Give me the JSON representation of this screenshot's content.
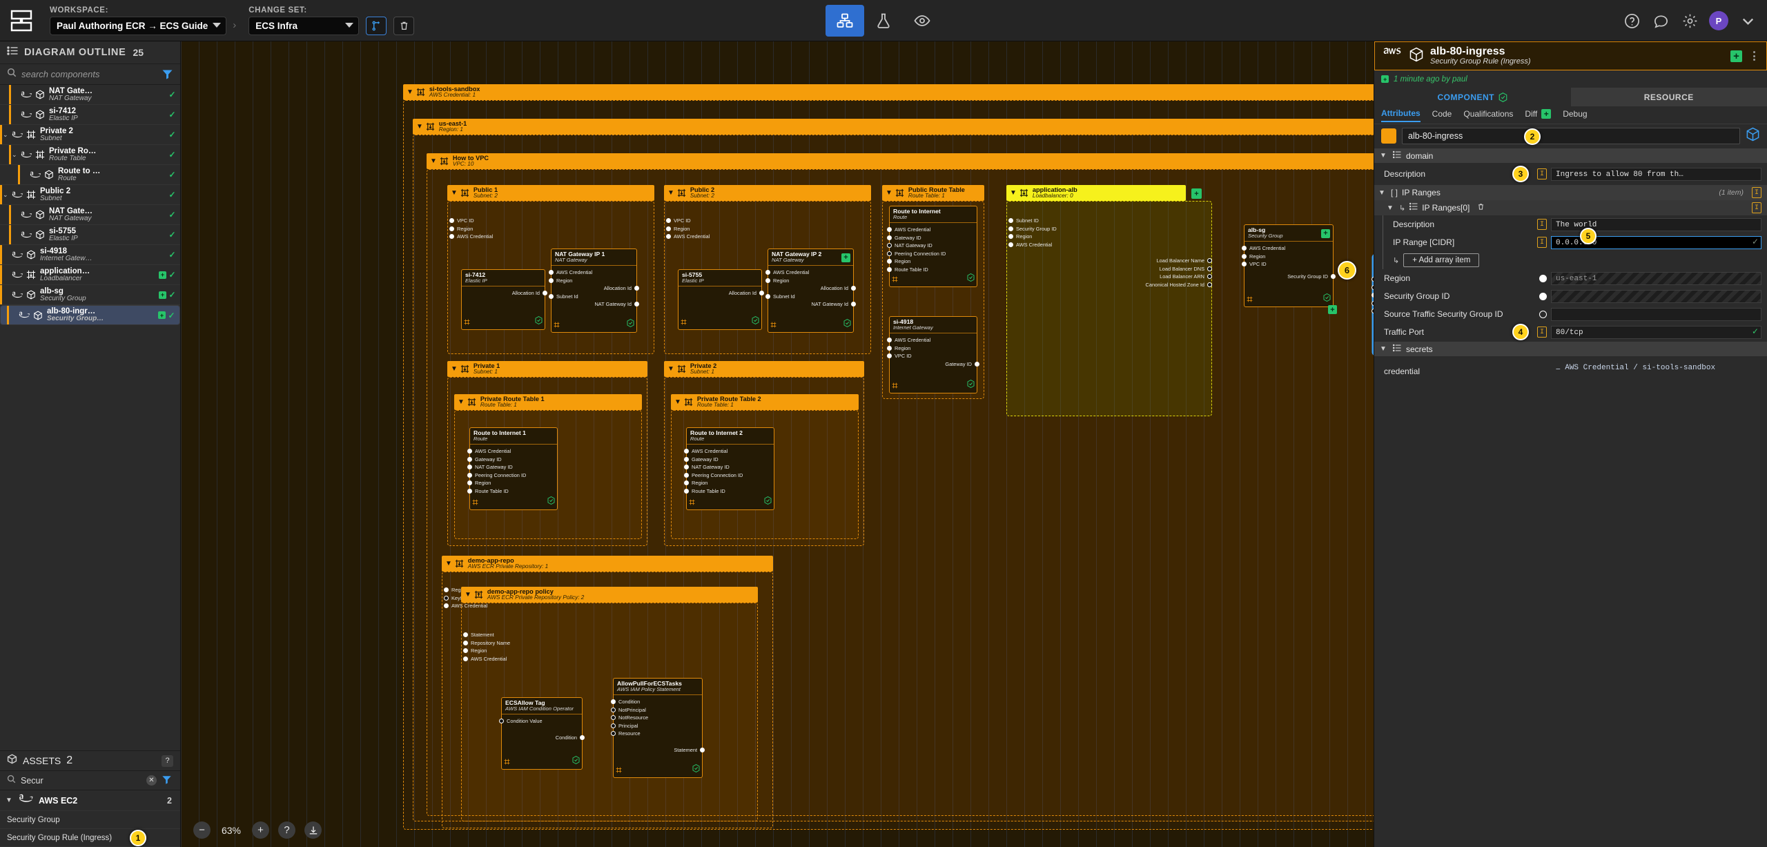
{
  "topbar": {
    "workspace_label": "WORKSPACE:",
    "workspace_value": "Paul Authoring ECR → ECS Guide",
    "changeset_label": "CHANGE SET:",
    "changeset_value": "ECS Infra",
    "separator": "›",
    "avatar_initial": "P"
  },
  "outline": {
    "title": "DIAGRAM OUTLINE",
    "count": "25",
    "search_placeholder": "search components",
    "items": [
      {
        "name": "NAT Gate…",
        "kind": "NAT Gateway",
        "depth": 2,
        "icon": "cube",
        "chevron": false,
        "plus": false,
        "check": true
      },
      {
        "name": "si-7412",
        "kind": "Elastic IP",
        "depth": 2,
        "icon": "cube",
        "chevron": false,
        "plus": false,
        "check": true
      },
      {
        "name": "Private 2",
        "kind": "Subnet",
        "depth": 1,
        "icon": "subnet",
        "chevron": true,
        "plus": false,
        "check": true
      },
      {
        "name": "Private Ro…",
        "kind": "Route Table",
        "depth": 2,
        "icon": "subnet",
        "chevron": true,
        "plus": false,
        "check": true
      },
      {
        "name": "Route to …",
        "kind": "Route",
        "depth": 3,
        "icon": "cube",
        "chevron": false,
        "plus": false,
        "check": true
      },
      {
        "name": "Public 2",
        "kind": "Subnet",
        "depth": 1,
        "icon": "subnet",
        "chevron": true,
        "plus": false,
        "check": true
      },
      {
        "name": "NAT Gate…",
        "kind": "NAT Gateway",
        "depth": 2,
        "icon": "cube",
        "chevron": false,
        "plus": false,
        "check": true
      },
      {
        "name": "si-5755",
        "kind": "Elastic IP",
        "depth": 2,
        "icon": "cube",
        "chevron": false,
        "plus": false,
        "check": true
      },
      {
        "name": "si-4918",
        "kind": "Internet Gatew…",
        "depth": 1,
        "icon": "cube",
        "chevron": false,
        "plus": false,
        "check": true
      },
      {
        "name": "application…",
        "kind": "Loadbalancer",
        "depth": 1,
        "icon": "subnet",
        "chevron": false,
        "plus": true,
        "check": true
      },
      {
        "name": "alb-sg",
        "kind": "Security Group",
        "depth": 1,
        "icon": "cube",
        "chevron": false,
        "plus": true,
        "check": true
      },
      {
        "name": "alb-80-ingr…",
        "kind": "Security Group…",
        "depth": 1,
        "icon": "cube",
        "chevron": false,
        "plus": true,
        "check": true,
        "selected": true
      }
    ]
  },
  "assets": {
    "title": "ASSETS",
    "count": "2",
    "help": "?",
    "search_value": "Secur",
    "group_name": "AWS EC2",
    "group_count": "2",
    "items": [
      {
        "label": "Security Group"
      },
      {
        "label": "Security Group Rule (Ingress)",
        "marker": "1"
      }
    ]
  },
  "canvas": {
    "zoom_level": "63%",
    "zoom_out": "−",
    "zoom_in": "+",
    "help": "?",
    "frames": [
      {
        "name": "si-tools-sandbox",
        "kind": "AWS Credential: 1"
      },
      {
        "name": "us-east-1",
        "kind": "Region: 1"
      },
      {
        "name": "How to VPC",
        "kind": "VPC: 10"
      },
      {
        "name": "Public 1",
        "kind": "Subnet: 2"
      },
      {
        "name": "Public 2",
        "kind": "Subnet: 2"
      },
      {
        "name": "Public Route Table",
        "kind": "Route Table: 1"
      },
      {
        "name": "application-alb",
        "kind": "Loadbalancer: 0"
      },
      {
        "name": "Private 1",
        "kind": "Subnet: 1"
      },
      {
        "name": "Private 2",
        "kind": "Subnet: 1"
      },
      {
        "name": "Private Route Table 1",
        "kind": "Route Table: 1"
      },
      {
        "name": "Private Route Table 2",
        "kind": "Route Table: 1"
      },
      {
        "name": "demo-app-repo",
        "kind": "AWS ECR Private Repository: 1"
      },
      {
        "name": "demo-app-repo policy",
        "kind": "AWS ECR Private Repository Policy: 2"
      }
    ],
    "nodes": {
      "si7412": {
        "name": "si-7412",
        "kind": "Elastic IP",
        "sockets": [
          "Allocation Id"
        ]
      },
      "natip1": {
        "name": "NAT Gateway IP 1",
        "kind": "NAT Gateway",
        "sockets": [
          "AWS Credential",
          "Region",
          "Subnet Id"
        ],
        "out": [
          "Allocation Id",
          "NAT Gateway Id"
        ]
      },
      "si5755": {
        "name": "si-5755",
        "kind": "Elastic IP",
        "sockets": [
          "Allocation Id"
        ]
      },
      "natip2": {
        "name": "NAT Gateway IP 2",
        "kind": "NAT Gateway",
        "sockets": [
          "AWS Credential",
          "Region",
          "Subnet Id"
        ],
        "out": [
          "Allocation Id",
          "NAT Gateway Id"
        ]
      },
      "rt_inet": {
        "name": "Route to Internet",
        "kind": "Route",
        "sockets": [
          "AWS Credential",
          "Gateway ID",
          "NAT Gateway ID",
          "Peering Connection ID",
          "Region",
          "Route Table ID"
        ]
      },
      "si4918": {
        "name": "si-4918",
        "kind": "Internet Gateway",
        "sockets": [
          "AWS Credential",
          "Region",
          "VPC ID"
        ],
        "out": [
          "Gateway ID"
        ]
      },
      "albsg": {
        "name": "alb-sg",
        "kind": "Security Group",
        "sockets": [
          "AWS Credential",
          "Region",
          "VPC ID"
        ],
        "out": [
          "Security Group ID"
        ]
      },
      "alb80": {
        "name": "alb-80-ingress",
        "kind": "Security Group Rule (Ingress)",
        "sockets": [
          "AWS Credential",
          "Region",
          "Security Group ID",
          "Source Traffic Security Group ID",
          "Traffic Port"
        ]
      },
      "rt_inet1": {
        "name": "Route to Internet 1",
        "kind": "Route",
        "sockets": [
          "AWS Credential",
          "Gateway ID",
          "NAT Gateway ID",
          "Peering Connection ID",
          "Region",
          "Route Table ID"
        ]
      },
      "rt_inet2": {
        "name": "Route to Internet 2",
        "kind": "Route",
        "sockets": [
          "AWS Credential",
          "Gateway ID",
          "NAT Gateway ID",
          "Peering Connection ID",
          "Region",
          "Route Table ID"
        ]
      },
      "ecsallow": {
        "name": "ECSAllow Tag",
        "kind": "AWS IAM Condition Operator",
        "sockets": [
          "Condition Value"
        ],
        "out": [
          "Condition"
        ]
      },
      "allowpull": {
        "name": "AllowPullForECSTasks",
        "kind": "AWS IAM Policy Statement",
        "sockets": [
          "Condition",
          "NotPrincipal",
          "NotResource",
          "Principal",
          "Resource"
        ],
        "out": [
          "Statement"
        ]
      }
    },
    "alb_outputs": [
      "Load Balancer Name",
      "Load Balancer DNS",
      "Load Balancer ARN",
      "Canonical Hosted Zone Id"
    ],
    "alb_inputs": [
      "Subnet ID",
      "Security Group ID",
      "Region",
      "AWS Credential"
    ],
    "subnet_inputs": [
      "VPC ID",
      "Region",
      "AWS Credential"
    ],
    "repo_inputs": [
      "Region",
      "KeyId",
      "AWS Credential"
    ],
    "policy_inputs": [
      "Statement",
      "Repository Name",
      "Region",
      "AWS Credential"
    ],
    "markers": {
      "m1": "1",
      "m2": "2",
      "m3": "3",
      "m4": "4",
      "m5": "5",
      "m6": "6"
    }
  },
  "rightpanel": {
    "title": "alb-80-ingress",
    "subtitle": "Security Group Rule (Ingress)",
    "meta": "1 minute ago by paul",
    "tabs": [
      {
        "label": "COMPONENT",
        "active": true
      },
      {
        "label": "RESOURCE",
        "active": false
      }
    ],
    "subtabs": [
      {
        "label": "Attributes",
        "active": true
      },
      {
        "label": "Code",
        "active": false
      },
      {
        "label": "Qualifications",
        "active": false
      },
      {
        "label": "Diff",
        "active": false,
        "plus": true
      },
      {
        "label": "Debug",
        "active": false
      }
    ],
    "name_value": "alb-80-ingress",
    "sections": [
      {
        "title": "domain",
        "attributes": [
          {
            "label": "Description",
            "value": "Ingress to allow 80 from th…",
            "type": "text"
          },
          {
            "label": "Region",
            "value": "us-east-1",
            "type": "hatch",
            "radio": "filled"
          },
          {
            "label": "Security Group ID",
            "value": "",
            "type": "hatch",
            "radio": "filled"
          },
          {
            "label": "Source Traffic Security Group ID",
            "value": "",
            "type": "blank",
            "radio": "hollow"
          },
          {
            "label": "Traffic Port",
            "value": "80/tcp",
            "type": "text",
            "ok": true
          }
        ],
        "array": {
          "title": "IP Ranges",
          "count": "(1 item)",
          "child_title": "IP Ranges[0]",
          "children": [
            {
              "label": "Description",
              "value": "The world"
            },
            {
              "label": "IP Range [CIDR]",
              "value": "0.0.0.0/0",
              "active": true,
              "ok": true
            }
          ],
          "add_label": "+ Add array item"
        }
      },
      {
        "title": "secrets",
        "attributes": [
          {
            "label": "credential",
            "value": "⚊ AWS Credential / si-tools-sandbox",
            "type": "chip"
          }
        ]
      }
    ]
  }
}
